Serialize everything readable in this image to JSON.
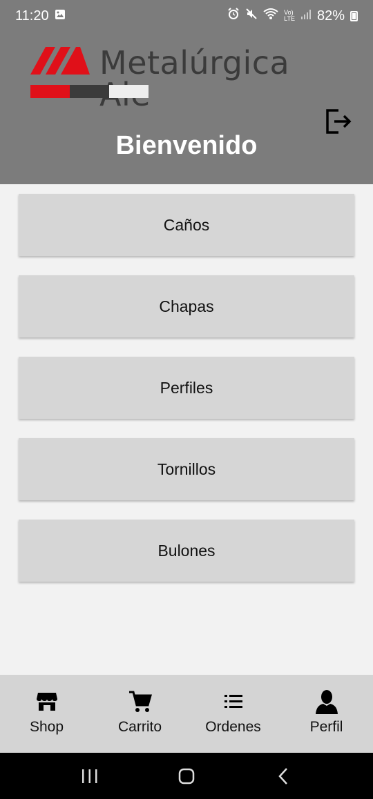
{
  "status": {
    "time": "11:20",
    "battery": "82%"
  },
  "header": {
    "brand": "Metalúrgica Ale",
    "welcome": "Bienvenido",
    "colors": {
      "bg": "#7c7c7c",
      "brand_red": "#e01019",
      "brand_dark": "#3b3b3b",
      "brand_light": "#eeeeee"
    }
  },
  "menu": {
    "items": [
      {
        "label": "Caños"
      },
      {
        "label": "Chapas"
      },
      {
        "label": "Perfiles"
      },
      {
        "label": "Tornillos"
      },
      {
        "label": "Bulones"
      }
    ]
  },
  "nav": {
    "items": [
      {
        "label": "Shop",
        "icon": "store-icon"
      },
      {
        "label": "Carrito",
        "icon": "cart-icon"
      },
      {
        "label": "Ordenes",
        "icon": "list-icon"
      },
      {
        "label": "Perfil",
        "icon": "person-icon"
      }
    ]
  }
}
